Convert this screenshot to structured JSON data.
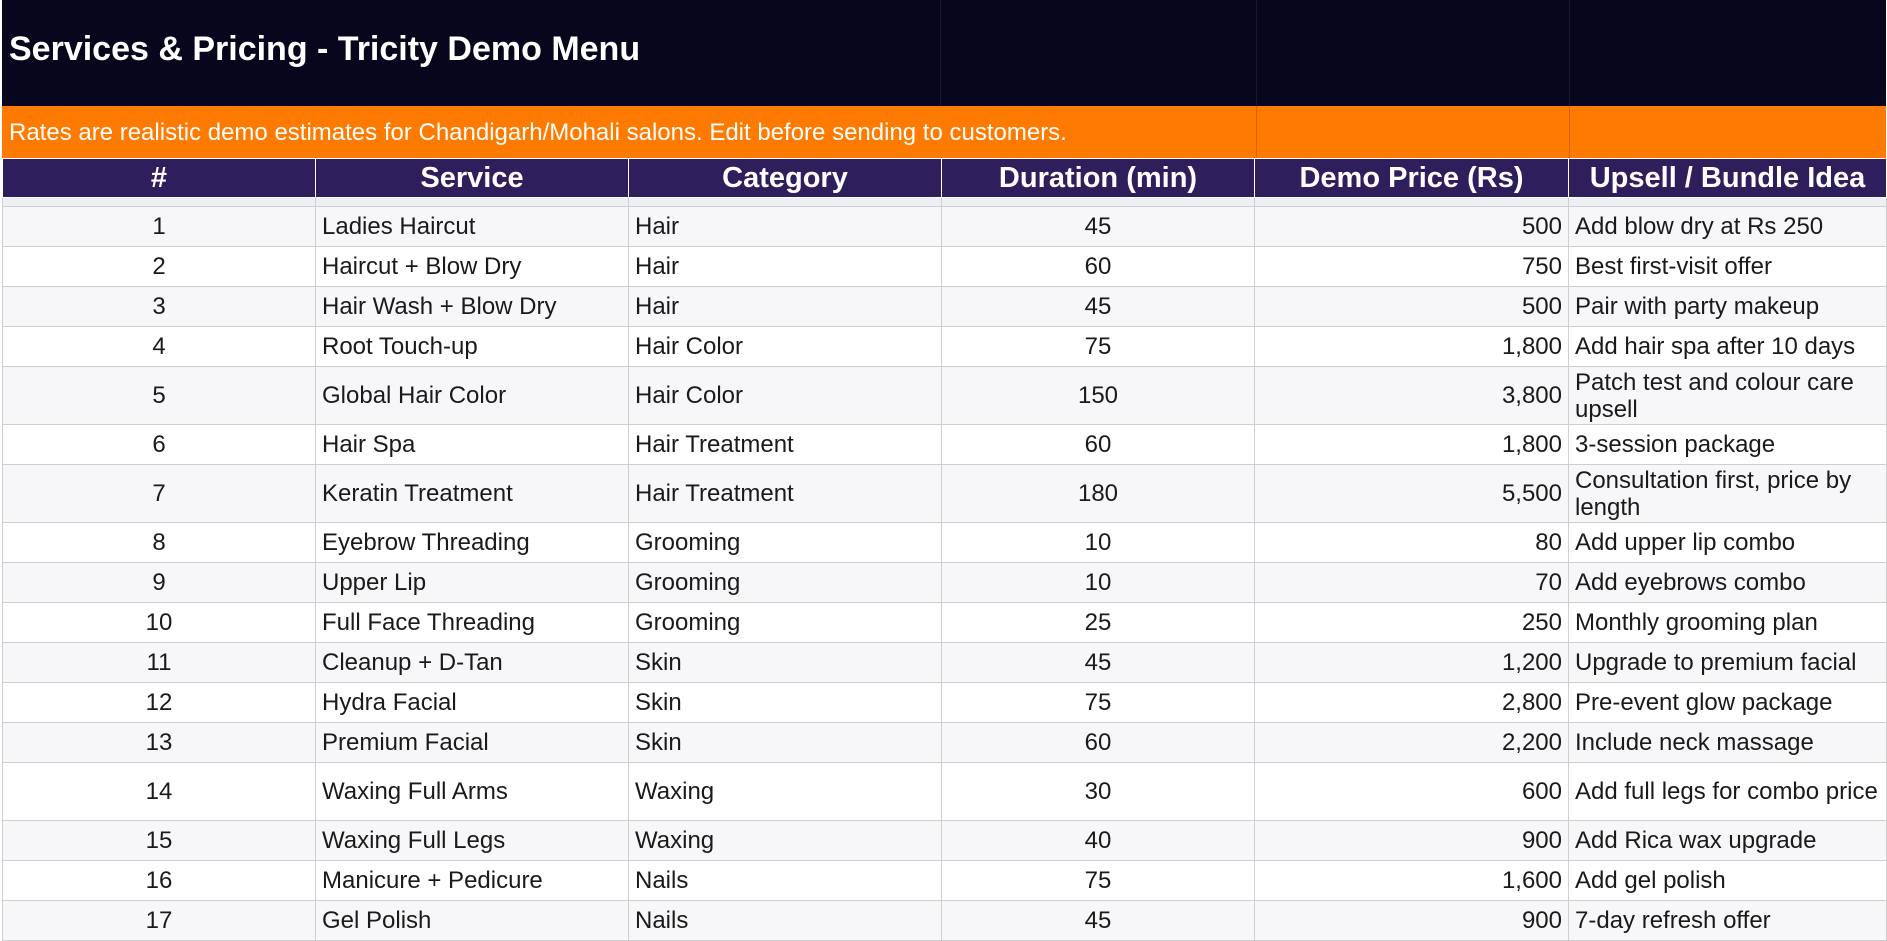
{
  "title": "Services & Pricing - Tricity Demo Menu",
  "notice": "Rates are realistic demo estimates for Chandigarh/Mohali salons. Edit before sending to customers.",
  "colors": {
    "title_band": "#07061c",
    "notice_band": "#ff7a00",
    "header_row": "#2e1e5c"
  },
  "headers": [
    "#",
    "Service",
    "Category",
    "Duration (min)",
    "Demo Price (Rs)",
    "Upsell / Bundle Idea"
  ],
  "rows": [
    {
      "num": "1",
      "service": "Ladies Haircut",
      "category": "Hair",
      "duration": "45",
      "price": "500",
      "idea": "Add blow dry at Rs 250"
    },
    {
      "num": "2",
      "service": "Haircut + Blow Dry",
      "category": "Hair",
      "duration": "60",
      "price": "750",
      "idea": "Best first-visit offer"
    },
    {
      "num": "3",
      "service": "Hair Wash + Blow Dry",
      "category": "Hair",
      "duration": "45",
      "price": "500",
      "idea": "Pair with party makeup"
    },
    {
      "num": "4",
      "service": "Root Touch-up",
      "category": "Hair Color",
      "duration": "75",
      "price": "1,800",
      "idea": "Add hair spa after 10 days"
    },
    {
      "num": "5",
      "service": "Global Hair Color",
      "category": "Hair Color",
      "duration": "150",
      "price": "3,800",
      "idea": "Patch test and colour care upsell"
    },
    {
      "num": "6",
      "service": "Hair Spa",
      "category": "Hair Treatment",
      "duration": "60",
      "price": "1,800",
      "idea": "3-session package"
    },
    {
      "num": "7",
      "service": "Keratin Treatment",
      "category": "Hair Treatment",
      "duration": "180",
      "price": "5,500",
      "idea": "Consultation first, price by length"
    },
    {
      "num": "8",
      "service": "Eyebrow Threading",
      "category": "Grooming",
      "duration": "10",
      "price": "80",
      "idea": "Add upper lip combo"
    },
    {
      "num": "9",
      "service": "Upper Lip",
      "category": "Grooming",
      "duration": "10",
      "price": "70",
      "idea": "Add eyebrows combo"
    },
    {
      "num": "10",
      "service": "Full Face Threading",
      "category": "Grooming",
      "duration": "25",
      "price": "250",
      "idea": "Monthly grooming plan"
    },
    {
      "num": "11",
      "service": "Cleanup + D-Tan",
      "category": "Skin",
      "duration": "45",
      "price": "1,200",
      "idea": "Upgrade to premium facial"
    },
    {
      "num": "12",
      "service": "Hydra Facial",
      "category": "Skin",
      "duration": "75",
      "price": "2,800",
      "idea": "Pre-event glow package"
    },
    {
      "num": "13",
      "service": "Premium Facial",
      "category": "Skin",
      "duration": "60",
      "price": "2,200",
      "idea": "Include neck massage"
    },
    {
      "num": "14",
      "service": "Waxing Full Arms",
      "category": "Waxing",
      "duration": "30",
      "price": "600",
      "idea": "Add full legs for combo price"
    },
    {
      "num": "15",
      "service": "Waxing Full Legs",
      "category": "Waxing",
      "duration": "40",
      "price": "900",
      "idea": "Add Rica wax upgrade"
    },
    {
      "num": "16",
      "service": "Manicure + Pedicure",
      "category": "Nails",
      "duration": "75",
      "price": "1,600",
      "idea": "Add gel polish"
    },
    {
      "num": "17",
      "service": "Gel Polish",
      "category": "Nails",
      "duration": "45",
      "price": "900",
      "idea": "7-day refresh offer"
    }
  ]
}
